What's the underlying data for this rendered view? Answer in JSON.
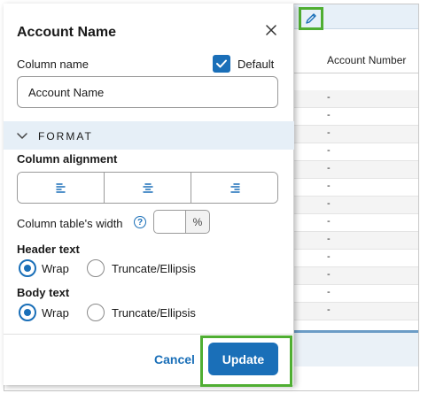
{
  "background_table": {
    "column_header": "Account Number",
    "cells": [
      "-",
      "-",
      "-",
      "-",
      "-",
      "-",
      "-",
      "-",
      "-",
      "-",
      "-",
      "-",
      "-"
    ]
  },
  "panel": {
    "title": "Account Name",
    "column_name_label": "Column name",
    "default_label": "Default",
    "default_checked": true,
    "column_name_value": "Account Name",
    "format_label": "FORMAT",
    "alignment_label": "Column alignment",
    "width_label": "Column table's width",
    "width_unit": "%",
    "header_text_label": "Header text",
    "body_text_label": "Body text",
    "wrap_label": "Wrap",
    "truncate_label": "Truncate/Ellipsis",
    "header_text_selected": "Wrap",
    "body_text_selected": "Wrap",
    "cancel_label": "Cancel",
    "update_label": "Update"
  },
  "colors": {
    "accent": "#1a6fb8",
    "highlight": "#4fae32",
    "format_band": "#e6eff7"
  }
}
